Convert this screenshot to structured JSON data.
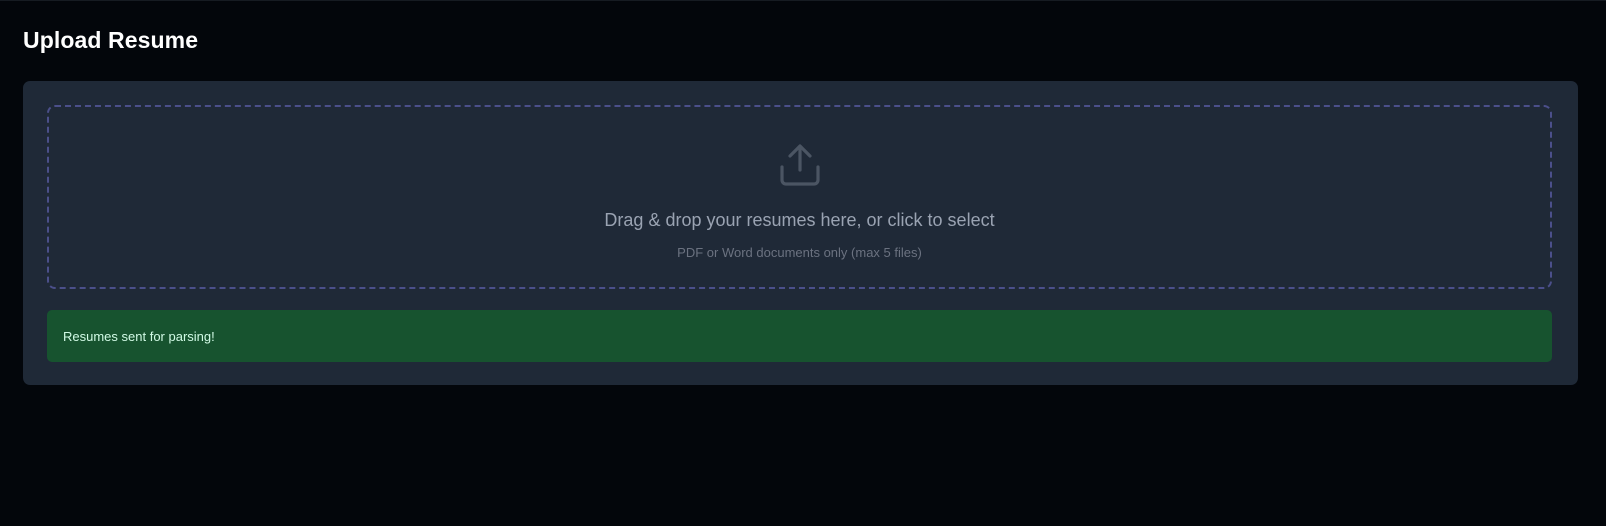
{
  "page": {
    "title": "Upload Resume"
  },
  "dropzone": {
    "icon": "upload-icon",
    "title": "Drag & drop your resumes here, or click to select",
    "subtitle": "PDF or Word documents only (max 5 files)"
  },
  "alert": {
    "message": "Resumes sent for parsing!",
    "status": "success"
  },
  "colors": {
    "background": "#03060b",
    "card": "#1f2937",
    "dropzone_border": "#4b4f8a",
    "success_bg": "#17532f",
    "success_text": "#d1fae5"
  }
}
